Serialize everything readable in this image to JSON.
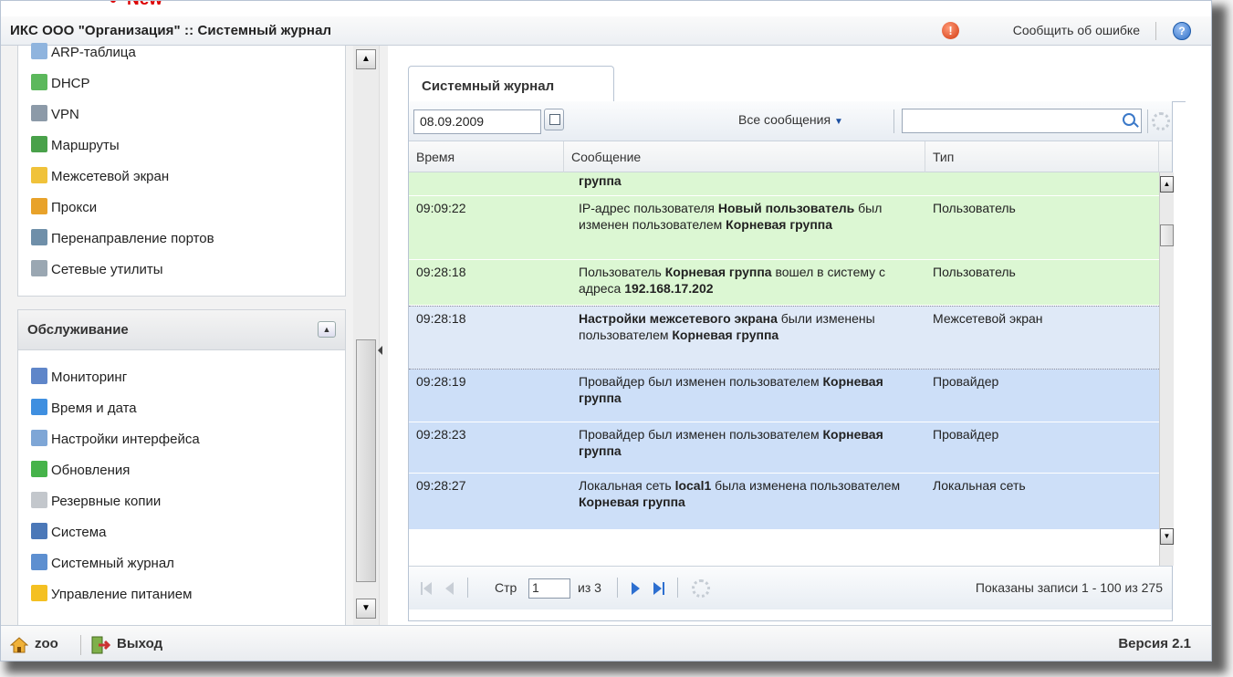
{
  "header": {
    "new_badge": "New",
    "title": "ИКС ООО \"Организация\" :: Системный журнал",
    "report_label": "Сообщить об ошибке",
    "report_icon_glyph": "!",
    "help_icon_glyph": "?"
  },
  "sidebar": {
    "network_items": [
      {
        "label": "ARP-таблица",
        "icon": "table-icon"
      },
      {
        "label": "DHCP",
        "icon": "dhcp-icon"
      },
      {
        "label": "VPN",
        "icon": "vpn-icon"
      },
      {
        "label": "Маршруты",
        "icon": "routes-icon"
      },
      {
        "label": "Межсетевой экран",
        "icon": "shield-icon"
      },
      {
        "label": "Прокси",
        "icon": "lock-icon"
      },
      {
        "label": "Перенаправление портов",
        "icon": "port-forward-icon"
      },
      {
        "label": "Сетевые утилиты",
        "icon": "wrench-icon"
      }
    ],
    "maintenance_title": "Обслуживание",
    "maintenance_items": [
      {
        "label": "Мониторинг",
        "icon": "chart-icon"
      },
      {
        "label": "Время и дата",
        "icon": "clock-icon"
      },
      {
        "label": "Настройки интерфейса",
        "icon": "interface-icon"
      },
      {
        "label": "Обновления",
        "icon": "update-icon"
      },
      {
        "label": "Резервные копии",
        "icon": "backup-icon"
      },
      {
        "label": "Система",
        "icon": "monitor-icon"
      },
      {
        "label": "Системный журнал",
        "icon": "book-icon"
      },
      {
        "label": "Управление питанием",
        "icon": "power-icon"
      }
    ]
  },
  "main": {
    "tab_label": "Системный журнал",
    "date_value": "08.09.2009",
    "filter_label": "Все сообщения",
    "search_value": "",
    "columns": [
      "Время",
      "Сообщение",
      "Тип"
    ],
    "rows": [
      {
        "time": "",
        "msg": [
          [
            "группа",
            true
          ]
        ],
        "type": "",
        "color": "green"
      },
      {
        "time": "09:09:22",
        "msg": [
          [
            "IP-адрес пользователя ",
            false
          ],
          [
            "Новый пользователь",
            true
          ],
          [
            " был изменен пользователем ",
            false
          ],
          [
            "Корневая группа",
            true
          ]
        ],
        "type": "Пользователь",
        "color": "green"
      },
      {
        "time": "09:28:18",
        "msg": [
          [
            "Пользователь ",
            false
          ],
          [
            "Корневая группа",
            true
          ],
          [
            " вошел в систему с адреса ",
            false
          ],
          [
            "192.168.17.202",
            true
          ]
        ],
        "type": "Пользователь",
        "color": "green"
      },
      {
        "time": "09:28:18",
        "msg": [
          [
            "Настройки межсетевого экрана",
            true
          ],
          [
            " были изменены пользователем ",
            false
          ],
          [
            "Корневая группа",
            true
          ]
        ],
        "type": "Межсетевой экран",
        "color": "sel"
      },
      {
        "time": "09:28:19",
        "msg": [
          [
            "Провайдер был изменен пользователем ",
            false
          ],
          [
            "Корневая группа",
            true
          ]
        ],
        "type": "Провайдер",
        "color": "blue"
      },
      {
        "time": "09:28:23",
        "msg": [
          [
            "Провайдер был изменен пользователем ",
            false
          ],
          [
            "Корневая группа",
            true
          ]
        ],
        "type": "Провайдер",
        "color": "blue"
      },
      {
        "time": "09:28:27",
        "msg": [
          [
            "Локальная сеть ",
            false
          ],
          [
            "local1",
            true
          ],
          [
            " была изменена пользователем ",
            false
          ],
          [
            "Корневая группа",
            true
          ]
        ],
        "type": "Локальная сеть",
        "color": "blue"
      }
    ],
    "pager": {
      "page_label": "Стр",
      "page_value": "1",
      "of_label": "из 3",
      "summary": "Показаны записи 1 - 100 из 275"
    }
  },
  "footer": {
    "user": "zoo",
    "logout": "Выход",
    "version": "Версия 2.1"
  },
  "colors": {
    "row_green": "#dcf7d3",
    "row_blue": "#cddff8",
    "row_selected": "#dfe9f7",
    "accent": "#2d6fd0",
    "new_badge": "#dd0000"
  }
}
